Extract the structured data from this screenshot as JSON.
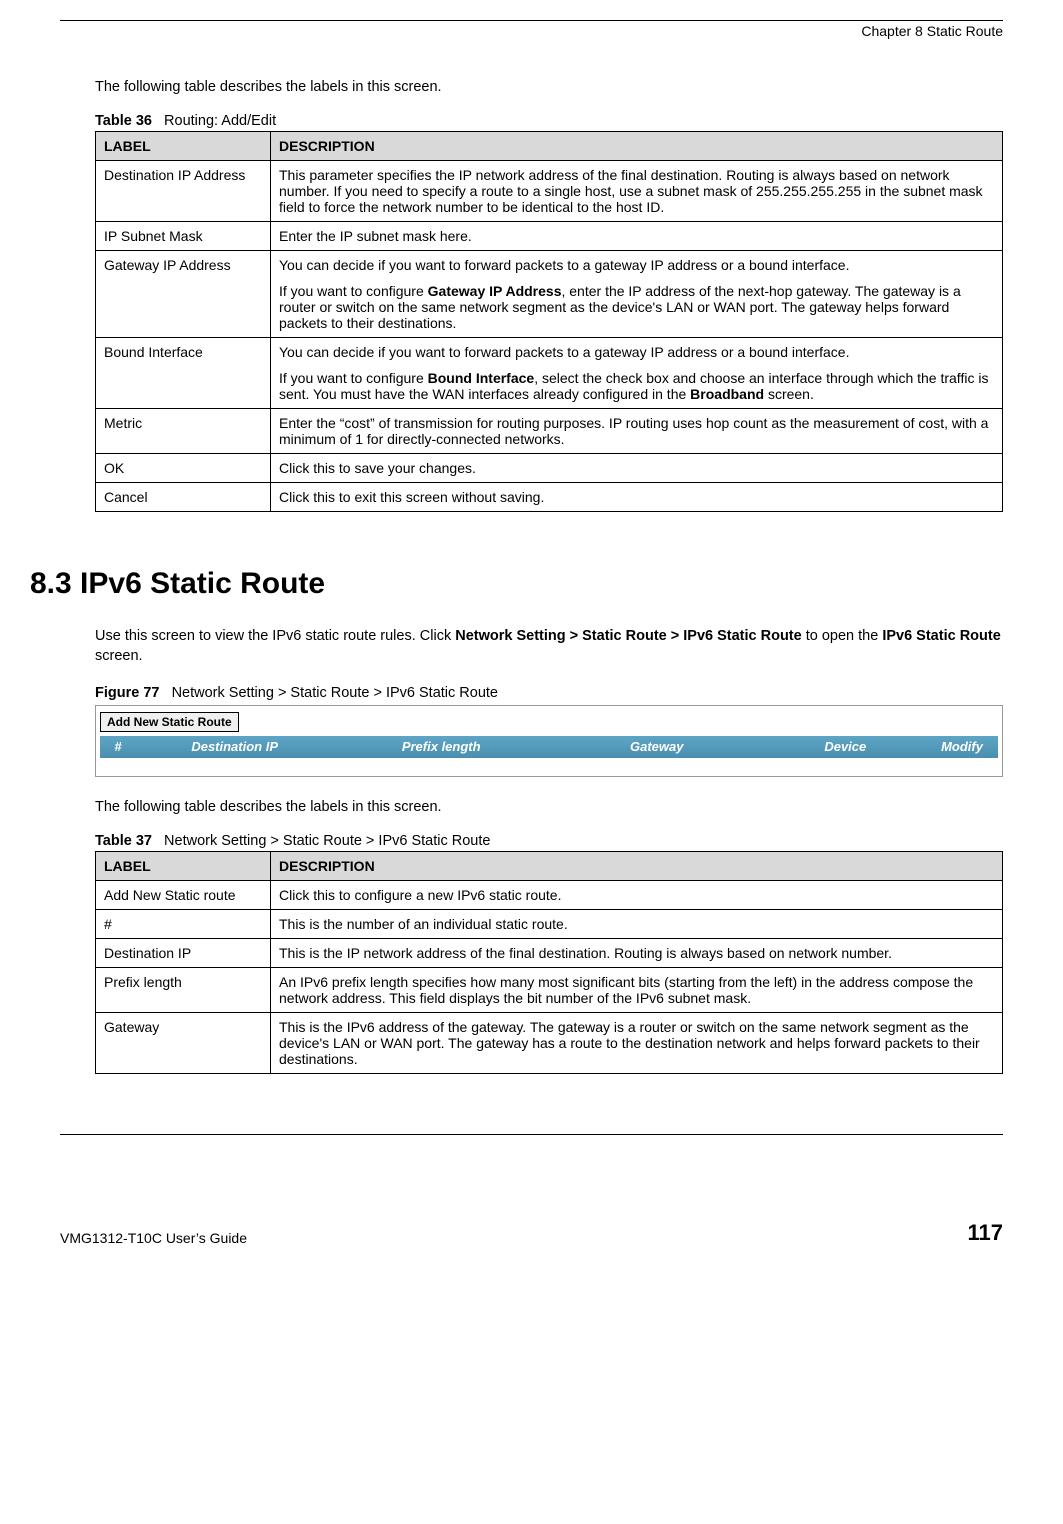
{
  "chapter_header": "Chapter 8 Static Route",
  "intro1": "The following table describes the labels in this screen.",
  "table36": {
    "caption_label": "Table 36",
    "caption_text": "Routing: Add/Edit",
    "header_label": "LABEL",
    "header_desc": "DESCRIPTION",
    "rows": [
      {
        "label": "Destination IP Address",
        "desc": "This parameter specifies the IP network address of the final destination.  Routing is always based on network number. If you need to specify a route to a single host, use a subnet mask of 255.255.255.255 in the subnet mask field to force the network number to be identical to the host ID."
      },
      {
        "label": "IP Subnet Mask",
        "desc": "Enter the IP subnet mask here."
      },
      {
        "label": "Gateway IP Address",
        "desc_p1": "You can decide if you want to forward packets to a gateway IP address or a bound interface.",
        "desc_p2a": "If you want to configure ",
        "desc_p2b": "Gateway IP Address",
        "desc_p2c": ", enter the IP address of the next-hop gateway. The gateway is a router or switch on the same network segment as the device's LAN or WAN port. The gateway helps forward packets to their destinations."
      },
      {
        "label": "Bound Interface",
        "desc_p1": "You can decide if you want to forward packets to a gateway IP address or a bound interface.",
        "desc_p2a": "If you want to configure ",
        "desc_p2b": "Bound Interface",
        "desc_p2c": ", select the check box and choose an interface through which the traffic is sent. You must have the WAN interfaces already configured in the ",
        "desc_p2d": "Broadband",
        "desc_p2e": " screen."
      },
      {
        "label": "Metric",
        "desc": "Enter the “cost” of transmission for routing purposes. IP routing uses hop count as the measurement of cost, with a minimum of 1 for directly-connected networks."
      },
      {
        "label": "OK",
        "desc": "Click this to save your changes."
      },
      {
        "label": "Cancel",
        "desc": "Click this to exit this screen without saving."
      }
    ]
  },
  "section83_heading": "8.3  IPv6 Static Route",
  "section83_body_a": "Use this screen to view the IPv6 static route rules. Click ",
  "section83_body_b": "Network Setting > Static Route > IPv6 Static Route",
  "section83_body_c": " to open the ",
  "section83_body_d": "IPv6 Static Route",
  "section83_body_e": " screen.",
  "figure77_label": "Figure 77",
  "figure77_text": "Network Setting > Static Route > IPv6 Static Route",
  "figure77": {
    "button": "Add New Static Route",
    "col_num": "#",
    "col_dest": "Destination IP",
    "col_prefix": "Prefix length",
    "col_gw": "Gateway",
    "col_dev": "Device",
    "col_mod": "Modify"
  },
  "intro2": "The following table describes the labels in this screen.",
  "table37": {
    "caption_label": "Table 37",
    "caption_text": "Network Setting > Static Route > IPv6 Static Route",
    "header_label": "LABEL",
    "header_desc": "DESCRIPTION",
    "rows": [
      {
        "label": "Add New Static route",
        "desc": "Click this to configure a new IPv6 static route."
      },
      {
        "label": "#",
        "desc": "This is the number of an individual static route."
      },
      {
        "label": "Destination IP",
        "desc": "This is the IP network address of the final destination. Routing is always based on network number."
      },
      {
        "label": "Prefix length",
        "desc": "An IPv6 prefix length specifies how many most significant bits (starting from the left) in the address compose the network address. This field displays the bit number of the IPv6 subnet mask."
      },
      {
        "label": "Gateway",
        "desc": "This is the IPv6 address of the gateway. The gateway is a router or switch on the same network segment as the device's LAN or WAN port. The gateway has a route to the destination network and helps forward packets to their destinations."
      }
    ]
  },
  "footer_guide": "VMG1312-T10C User’s Guide",
  "footer_page": "117"
}
